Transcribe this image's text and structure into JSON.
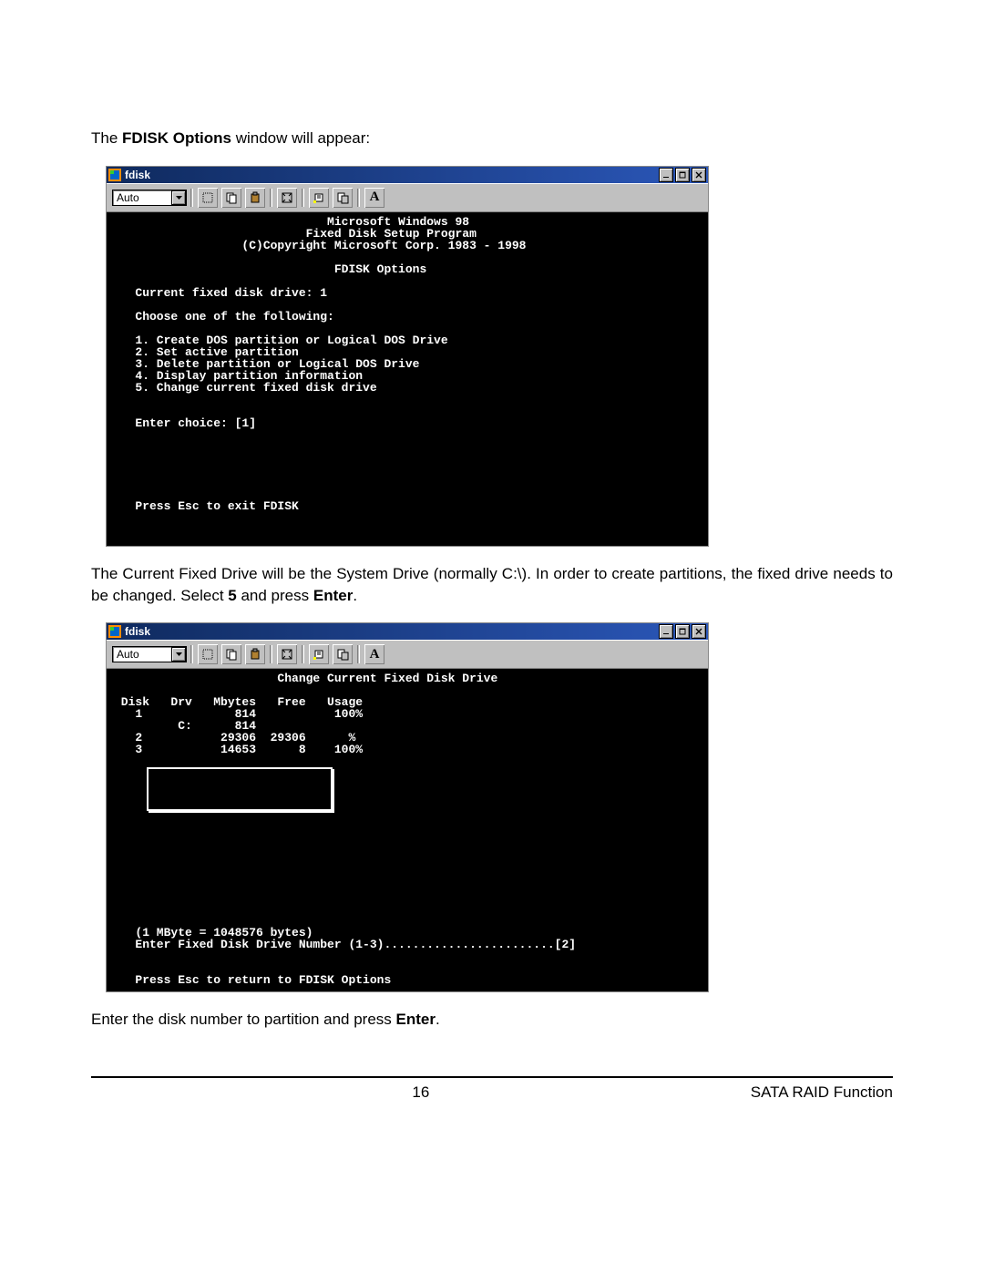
{
  "intro_prefix": "The ",
  "intro_bold": "FDISK Options",
  "intro_suffix": " window will appear:",
  "win1": {
    "title": "fdisk",
    "combo": "Auto",
    "text": "                              Microsoft Windows 98\n                           Fixed Disk Setup Program\n                  (C)Copyright Microsoft Corp. 1983 - 1998\n\n                               FDISK Options\n\n   Current fixed disk drive: 1\n\n   Choose one of the following:\n\n   1. Create DOS partition or Logical DOS Drive\n   2. Set active partition\n   3. Delete partition or Logical DOS Drive\n   4. Display partition information\n   5. Change current fixed disk drive\n\n\n   Enter choice: [1]\n\n\n\n\n\n\n   Press Esc to exit FDISK"
  },
  "mid_prefix": "The Current Fixed Drive will be the System Drive (normally C:\\). In order to create partitions, the fixed drive needs to be changed. Select ",
  "mid_bold1": "5",
  "mid_mid": " and press ",
  "mid_bold2": "Enter",
  "mid_suffix": ".",
  "win2": {
    "title": "fdisk",
    "combo": "Auto",
    "text_top": "                       Change Current Fixed Disk Drive\n\n Disk   Drv   Mbytes   Free   Usage\n   1             814           100%\n         C:      814\n   2           29306  29306      %\n   3           14653      8    100%",
    "text_bottom": "   (1 MByte = 1048576 bytes)\n   Enter Fixed Disk Drive Number (1-3)........................[2]\n\n\n   Press Esc to return to FDISK Options"
  },
  "outro_prefix": "Enter the disk number to partition and press ",
  "outro_bold": "Enter",
  "outro_suffix": ".",
  "footer": {
    "page": "16",
    "right": "SATA RAID Function"
  },
  "chart_data": {
    "type": "table",
    "title": "Change Current Fixed Disk Drive",
    "columns": [
      "Disk",
      "Drv",
      "Mbytes",
      "Free",
      "Usage"
    ],
    "rows": [
      {
        "Disk": 1,
        "Drv": "",
        "Mbytes": 814,
        "Free": null,
        "Usage": "100%"
      },
      {
        "Disk": null,
        "Drv": "C:",
        "Mbytes": 814,
        "Free": null,
        "Usage": null
      },
      {
        "Disk": 2,
        "Drv": "",
        "Mbytes": 29306,
        "Free": 29306,
        "Usage": "%"
      },
      {
        "Disk": 3,
        "Drv": "",
        "Mbytes": 14653,
        "Free": 8,
        "Usage": "100%"
      }
    ],
    "note": "1 MByte = 1048576 bytes",
    "prompt": "Enter Fixed Disk Drive Number (1-3)",
    "prompt_value": 2
  }
}
